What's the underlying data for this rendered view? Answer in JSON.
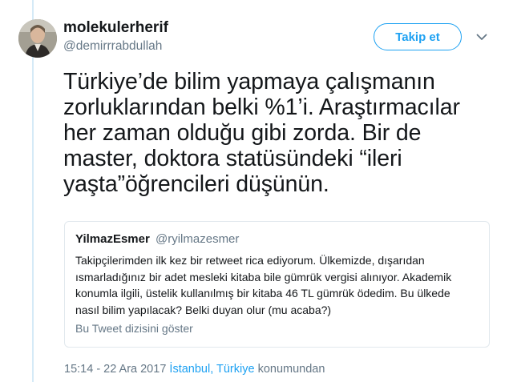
{
  "author": {
    "display_name": "molekulerherif",
    "username": "@demirrrabdullah"
  },
  "follow_button_label": "Takip et",
  "tweet": {
    "lines": [
      "Türkiye’de bilim yapmaya çalışmanın",
      "zorluklarından belki %1’i. Araştırmacılar",
      "her zaman olduğu gibi zorda. Bir de",
      "master, doktora statüsündeki “ileri",
      "yaşta”öğrencileri düşünün."
    ]
  },
  "quoted_tweet": {
    "display_name": "YilmazEsmer",
    "username": "@ryilmazesmer",
    "lines": [
      "Takipçilerimden ilk kez bir retweet rica ediyorum. Ülkemizde, dışarıdan",
      "ısmarladığınız bir adet mesleki kitaba bile gümrük vergisi alınıyor. Akademik",
      "konumla ilgili, üstelik kullanılmış bir kitaba 46 TL gümrük ödedim. Bu ülkede",
      "nasıl bilim yapılacak? Belki duyan olur (mu acaba?)"
    ],
    "thread_link_label": "Bu Tweet dizisini göster"
  },
  "meta": {
    "timestamp": "15:14 - 22 Ara 2017",
    "location": "İstanbul, Türkiye",
    "location_suffix": "konumundan"
  },
  "colors": {
    "accent": "#1da1f2",
    "secondary_text": "#657786",
    "thread_line": "#d5eaf7",
    "border": "#e1e8ed"
  },
  "icons": {
    "caret": "chevron-down-icon"
  }
}
